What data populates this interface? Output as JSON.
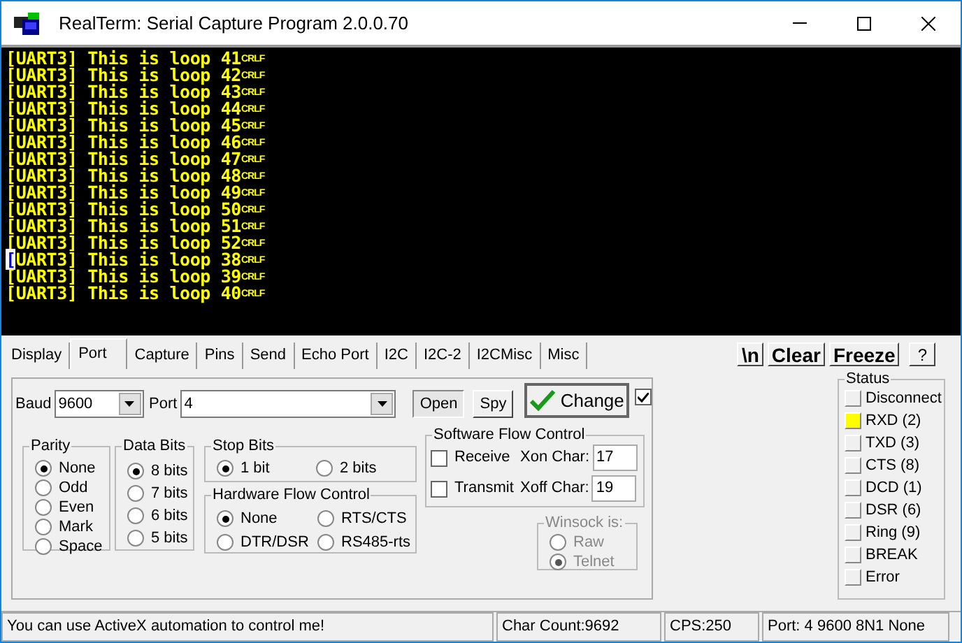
{
  "window": {
    "title": "RealTerm: Serial Capture Program 2.0.0.70"
  },
  "terminal": {
    "lines": [
      {
        "text": "[UART3] This is loop 41",
        "eol": "CRLF",
        "cursor": false
      },
      {
        "text": "[UART3] This is loop 42",
        "eol": "CRLF",
        "cursor": false
      },
      {
        "text": "[UART3] This is loop 43",
        "eol": "CRLF",
        "cursor": false
      },
      {
        "text": "[UART3] This is loop 44",
        "eol": "CRLF",
        "cursor": false
      },
      {
        "text": "[UART3] This is loop 45",
        "eol": "CRLF",
        "cursor": false
      },
      {
        "text": "[UART3] This is loop 46",
        "eol": "CRLF",
        "cursor": false
      },
      {
        "text": "[UART3] This is loop 47",
        "eol": "CRLF",
        "cursor": false
      },
      {
        "text": "[UART3] This is loop 48",
        "eol": "CRLF",
        "cursor": false
      },
      {
        "text": "[UART3] This is loop 49",
        "eol": "CRLF",
        "cursor": false
      },
      {
        "text": "[UART3] This is loop 50",
        "eol": "CRLF",
        "cursor": false
      },
      {
        "text": "[UART3] This is loop 51",
        "eol": "CRLF",
        "cursor": false
      },
      {
        "text": "[UART3] This is loop 52",
        "eol": "CRLF",
        "cursor": false
      },
      {
        "text": "[UART3] This is loop 38",
        "eol": "CRLF",
        "cursor": true
      },
      {
        "text": "[UART3] This is loop 39",
        "eol": "CRLF",
        "cursor": false
      },
      {
        "text": "[UART3] This is loop 40",
        "eol": "CRLF",
        "cursor": false
      }
    ]
  },
  "tabs": [
    {
      "label": "Display",
      "selected": false
    },
    {
      "label": "Port",
      "selected": true
    },
    {
      "label": "Capture",
      "selected": false
    },
    {
      "label": "Pins",
      "selected": false
    },
    {
      "label": "Send",
      "selected": false
    },
    {
      "label": "Echo Port",
      "selected": false
    },
    {
      "label": "I2C",
      "selected": false
    },
    {
      "label": "I2C-2",
      "selected": false
    },
    {
      "label": "I2CMisc",
      "selected": false
    },
    {
      "label": "Misc",
      "selected": false
    }
  ],
  "toolbar_buttons": [
    "\\n",
    "Clear",
    "Freeze",
    "?"
  ],
  "port": {
    "baud_label": "Baud",
    "baud": "9600",
    "port_label": "Port",
    "port": "4",
    "open_button": {
      "label": "Open",
      "pressed": true
    },
    "spy_button": "Spy",
    "change_button": "Change",
    "change_checked": true,
    "parity": {
      "title": "Parity",
      "options": [
        {
          "label": "None",
          "selected": true
        },
        {
          "label": "Odd",
          "selected": false
        },
        {
          "label": "Even",
          "selected": false
        },
        {
          "label": "Mark",
          "selected": false
        },
        {
          "label": "Space",
          "selected": false
        }
      ]
    },
    "data_bits": {
      "title": "Data Bits",
      "options": [
        {
          "label": "8 bits",
          "selected": true
        },
        {
          "label": "7 bits",
          "selected": false
        },
        {
          "label": "6 bits",
          "selected": false
        },
        {
          "label": "5 bits",
          "selected": false
        }
      ]
    },
    "stop_bits": {
      "title": "Stop Bits",
      "options": [
        {
          "label": "1 bit",
          "selected": true
        },
        {
          "label": "2 bits",
          "selected": false
        }
      ]
    },
    "hardware_flow": {
      "title": "Hardware Flow Control",
      "options": [
        {
          "label": "None",
          "selected": true
        },
        {
          "label": "RTS/CTS",
          "selected": false
        },
        {
          "label": "DTR/DSR",
          "selected": false
        },
        {
          "label": "RS485-rts",
          "selected": false
        }
      ]
    },
    "software_flow": {
      "title": "Software Flow Control",
      "rows": [
        {
          "label": "Receive",
          "checked": false,
          "char_label": "Xon Char:",
          "value": "17"
        },
        {
          "label": "Transmit",
          "checked": false,
          "char_label": "Xoff Char:",
          "value": "19"
        }
      ]
    },
    "winsock": {
      "title": "Winsock is:",
      "disabled": true,
      "options": [
        {
          "label": "Raw",
          "selected": false
        },
        {
          "label": "Telnet",
          "selected": true
        }
      ]
    }
  },
  "status": {
    "title": "Status",
    "items": [
      {
        "label": "Disconnect",
        "on": false
      },
      {
        "label": "RXD (2)",
        "on": true
      },
      {
        "label": "TXD (3)",
        "on": false
      },
      {
        "label": "CTS (8)",
        "on": false
      },
      {
        "label": "DCD (1)",
        "on": false
      },
      {
        "label": "DSR (6)",
        "on": false
      },
      {
        "label": "Ring (9)",
        "on": false
      },
      {
        "label": "BREAK",
        "on": false
      },
      {
        "label": "Error",
        "on": false
      }
    ]
  },
  "status_bar": [
    "You can use ActiveX automation to control me!",
    "Char Count:9692",
    "CPS:250",
    "Port: 4 9600 8N1 None"
  ]
}
